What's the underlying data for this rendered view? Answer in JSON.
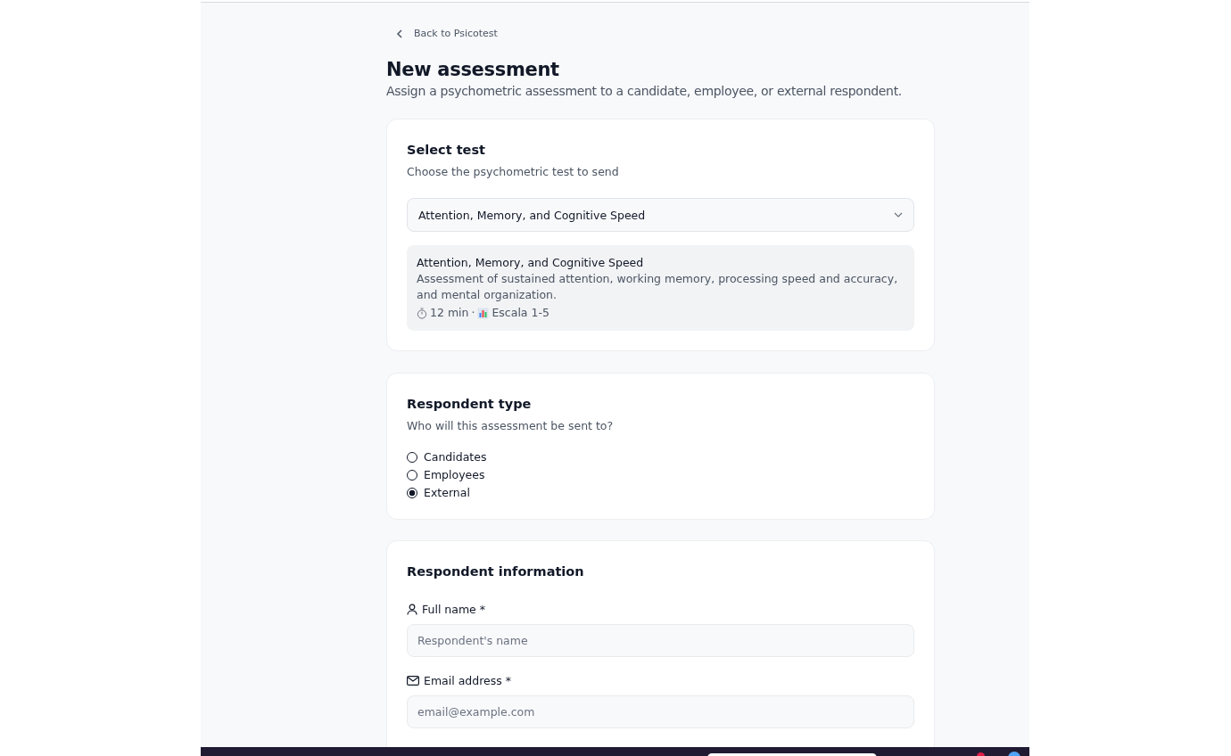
{
  "back_link": "Back to Psicotest",
  "title": "New assessment",
  "subtitle": "Assign a psychometric assessment to a candidate, employee, or external respondent.",
  "select_test": {
    "heading": "Select test",
    "hint": "Choose the psychometric test to send",
    "value": "Attention, Memory, and Cognitive Speed",
    "summary": {
      "name": "Attention, Memory, and Cognitive Speed",
      "description": "Assessment of sustained attention, working memory, processing speed and accuracy, and mental organization.",
      "duration": "12 min",
      "separator": "·",
      "scale": "Escala 1-5"
    }
  },
  "respondent_type": {
    "heading": "Respondent type",
    "hint": "Who will this assessment be sent to?",
    "options": [
      {
        "label": "Candidates",
        "selected": false
      },
      {
        "label": "Employees",
        "selected": false
      },
      {
        "label": "External",
        "selected": true
      }
    ]
  },
  "respondent_information": {
    "heading": "Respondent information",
    "fields": [
      {
        "kind": "person",
        "label": "Full name *",
        "placeholder": "Respondent's name"
      },
      {
        "kind": "email",
        "label": "Email address *",
        "placeholder": "email@example.com"
      }
    ]
  }
}
